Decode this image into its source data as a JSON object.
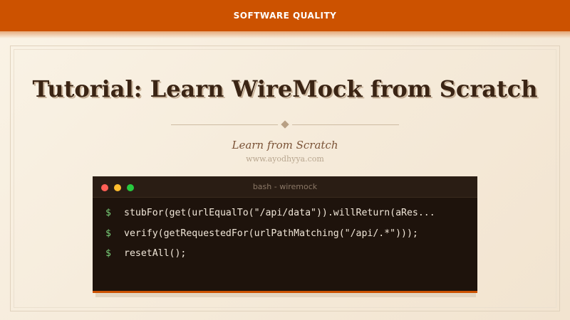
{
  "header": {
    "category": "SOFTWARE QUALITY",
    "accent_color": "#cc5200"
  },
  "hero": {
    "title": "Tutorial: Learn WireMock from Scratch",
    "subtitle": "Learn from Scratch",
    "website": "www.ayodhyya.com"
  },
  "terminal": {
    "window_title": "bash - wiremock",
    "window_buttons": [
      "close",
      "minimize",
      "maximize"
    ],
    "prompt": "$",
    "lines": [
      "stubFor(get(urlEqualTo(\"/api/data\")).willReturn(aRes...",
      "verify(getRequestedFor(urlPathMatching(\"/api/.*\")));",
      "resetAll();"
    ]
  }
}
